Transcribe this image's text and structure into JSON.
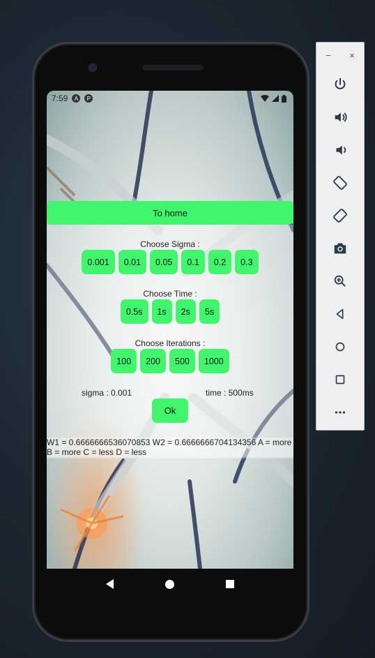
{
  "status_bar": {
    "time": "7:59",
    "icon_a": "A",
    "icon_p": "P"
  },
  "home_button_label": "To home",
  "sigma": {
    "label": "Choose Sigma :",
    "options": [
      "0.001",
      "0.01",
      "0.05",
      "0.1",
      "0.2",
      "0.3"
    ]
  },
  "time": {
    "label": "Choose Time :",
    "options": [
      "0.5s",
      "1s",
      "2s",
      "5s"
    ]
  },
  "iterations": {
    "label": "Choose Iterations :",
    "options": [
      "100",
      "200",
      "500",
      "1000"
    ]
  },
  "selection": {
    "sigma_text": "sigma : 0.001",
    "time_text": "time : 500ms"
  },
  "ok_label": "Ok",
  "result_text": "W1 = 0.6666666536070853 W2 = 0.6666666704134356 A = more B = more C = less D = less",
  "emulator_panel": {
    "minimize": "−",
    "close": "×",
    "buttons": [
      "power-icon",
      "volume-up-icon",
      "volume-down-icon",
      "rotate-left-icon",
      "rotate-right-icon",
      "camera-icon",
      "zoom-icon",
      "back-icon",
      "home-icon",
      "overview-icon",
      "more-icon"
    ]
  },
  "colors": {
    "accent_green": "#41f56c"
  }
}
